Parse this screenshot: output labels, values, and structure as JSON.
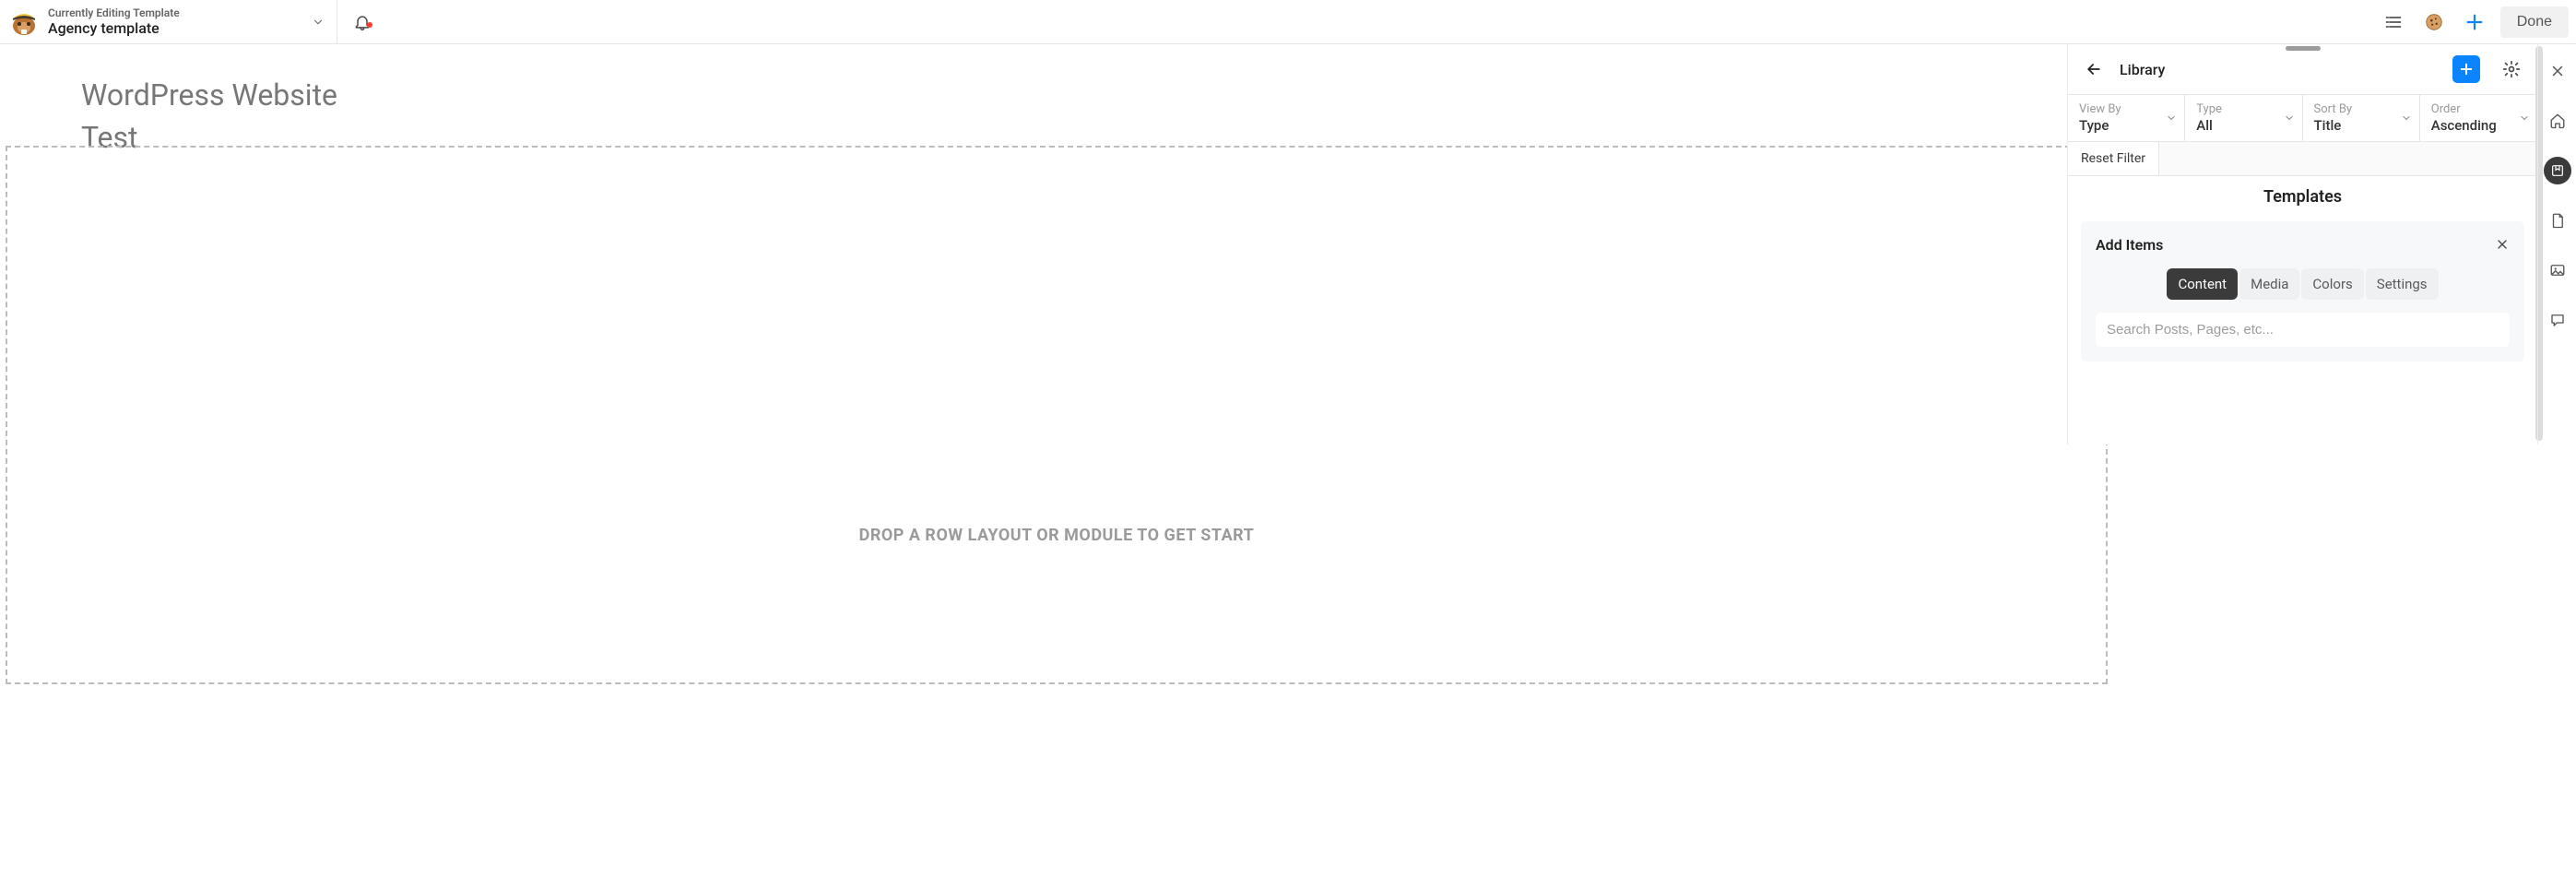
{
  "header": {
    "editing_label": "Currently Editing Template",
    "template_name": "Agency template",
    "done_label": "Done"
  },
  "page": {
    "site_title": "WordPress Website",
    "site_subtitle": "Test",
    "dropzone_text": "DROP A ROW LAYOUT OR MODULE TO GET START"
  },
  "library": {
    "title": "Library",
    "filters": {
      "view_by": {
        "label": "View By",
        "value": "Type"
      },
      "type": {
        "label": "Type",
        "value": "All"
      },
      "sort_by": {
        "label": "Sort By",
        "value": "Title"
      },
      "order": {
        "label": "Order",
        "value": "Ascending"
      }
    },
    "reset_label": "Reset Filter",
    "section_heading": "Templates",
    "add_items": {
      "title": "Add Items",
      "tabs": [
        "Content",
        "Media",
        "Colors",
        "Settings"
      ],
      "active_tab": "Content",
      "search_placeholder": "Search Posts, Pages, etc..."
    }
  }
}
